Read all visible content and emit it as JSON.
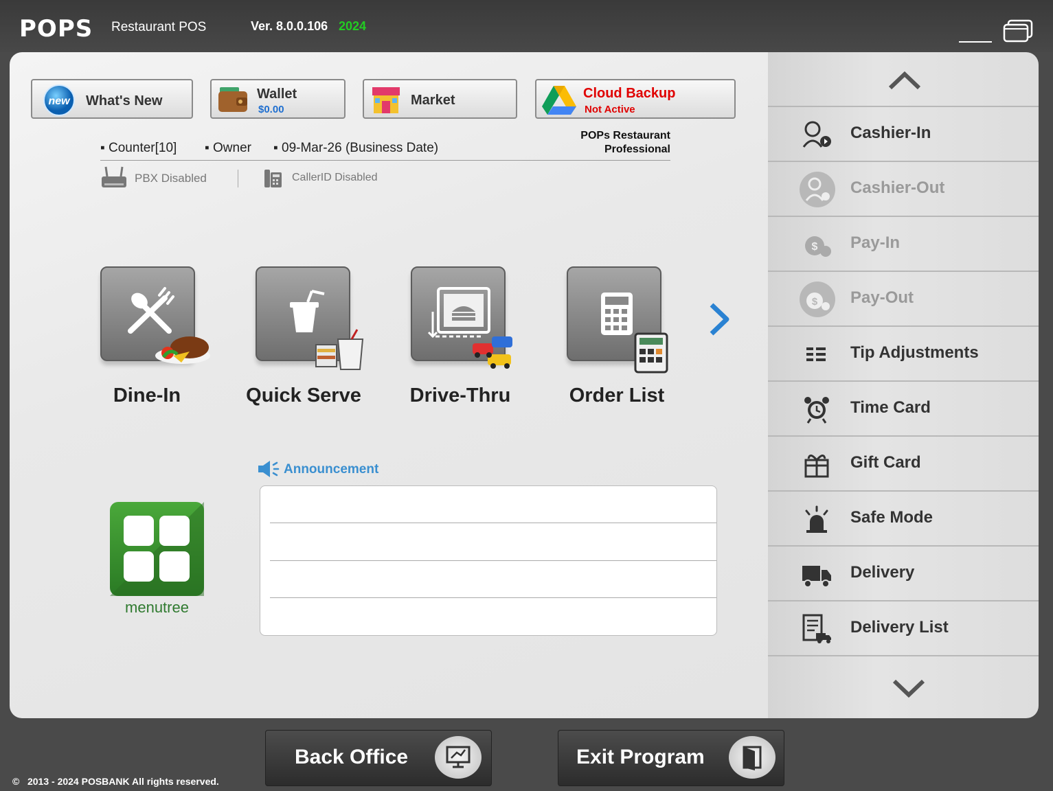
{
  "titlebar": {
    "logo": "POPS",
    "logo_sub": "Restaurant POS",
    "version": "Ver. 8.0.0.106",
    "version_year": "2024"
  },
  "top_buttons": {
    "whats_new": {
      "badge": "new",
      "label": "What's New"
    },
    "wallet": {
      "label": "Wallet",
      "amount": "$0.00"
    },
    "market": {
      "label": "Market"
    },
    "cloud_backup": {
      "label": "Cloud Backup",
      "status": "Not Active"
    }
  },
  "edition": {
    "line1": "POPs Restaurant",
    "line2": "Professional"
  },
  "info": {
    "counter": "Counter[10]",
    "user": "Owner",
    "business_date": "09-Mar-26 (Business Date)",
    "pbx": "PBX Disabled",
    "callerid": "CallerID Disabled"
  },
  "tiles": [
    {
      "label": "Dine-In"
    },
    {
      "label": "Quick Serve"
    },
    {
      "label": "Drive-Thru"
    },
    {
      "label": "Order List"
    }
  ],
  "menutree": {
    "label": "menutree"
  },
  "announcement": {
    "title": "Announcement"
  },
  "sidebar": {
    "items": [
      {
        "label": "Cashier-In",
        "icon": "cashier-in-icon",
        "enabled": true
      },
      {
        "label": "Cashier-Out",
        "icon": "cashier-out-icon",
        "enabled": false
      },
      {
        "label": "Pay-In",
        "icon": "pay-in-icon",
        "enabled": false
      },
      {
        "label": "Pay-Out",
        "icon": "pay-out-icon",
        "enabled": false
      },
      {
        "label": "Tip Adjustments",
        "icon": "tip-adjustments-icon",
        "enabled": true
      },
      {
        "label": "Time Card",
        "icon": "alarm-clock-icon",
        "enabled": true
      },
      {
        "label": "Gift Card",
        "icon": "gift-icon",
        "enabled": true
      },
      {
        "label": "Safe Mode",
        "icon": "siren-icon",
        "enabled": true
      },
      {
        "label": "Delivery",
        "icon": "truck-icon",
        "enabled": true
      },
      {
        "label": "Delivery List",
        "icon": "delivery-list-icon",
        "enabled": true
      }
    ]
  },
  "bottom": {
    "back_office": "Back Office",
    "exit_program": "Exit Program",
    "copyright": "2013 - 2024 POSBANK All rights reserved."
  },
  "colors": {
    "accent_blue": "#3a8fd0",
    "cloud_red": "#e00000",
    "year_green": "#22cc22",
    "disabled_text": "#9a9a9a"
  }
}
